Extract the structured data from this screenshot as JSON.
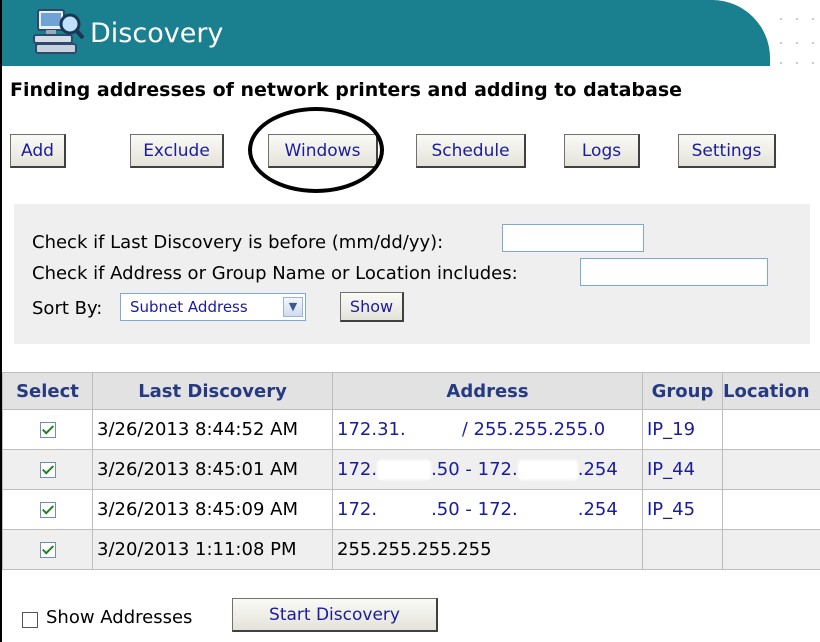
{
  "header": {
    "title": "Discovery",
    "logo_icon": "network-discovery-icon",
    "bg_color": "#1a7f8e"
  },
  "subtitle": "Finding addresses of network printers and adding to database",
  "toolbar": {
    "add": "Add",
    "exclude": "Exclude",
    "windows": "Windows",
    "schedule": "Schedule",
    "logs": "Logs",
    "settings": "Settings"
  },
  "filters": {
    "last_discovery_label": "Check if Last Discovery is before (mm/dd/yy):",
    "last_discovery_value": "",
    "address_label": "Check if Address or Group Name or Location includes:",
    "address_value": "",
    "sort_label": "Sort By:",
    "sort_value": "Subnet Address",
    "show_button": "Show"
  },
  "table": {
    "headers": [
      "Select",
      "Last Discovery",
      "Address",
      "Group",
      "Location"
    ],
    "rows": [
      {
        "checked": true,
        "last_discovery": "3/26/2013 8:44:52 AM",
        "address_a": "172.31.",
        "address_b": "/ 255.255.255.0",
        "group": "IP_19",
        "location": ""
      },
      {
        "checked": true,
        "last_discovery": "3/26/2013 8:45:01 AM",
        "address_a": "172.",
        "address_b": ".50 - 172.",
        "address_c": ".254",
        "group": "IP_44",
        "location": ""
      },
      {
        "checked": true,
        "last_discovery": "3/26/2013 8:45:09 AM",
        "address_a": "172.",
        "address_b": ".50 - 172.",
        "address_c": ".254",
        "group": "IP_45",
        "location": ""
      },
      {
        "checked": true,
        "last_discovery": "3/20/2013 1:11:08 PM",
        "address_a": "255.255.255.255",
        "group": "",
        "location": ""
      }
    ]
  },
  "bottom": {
    "show_addresses_label": "Show Addresses",
    "show_addresses_checked": false,
    "start_button": "Start Discovery"
  }
}
